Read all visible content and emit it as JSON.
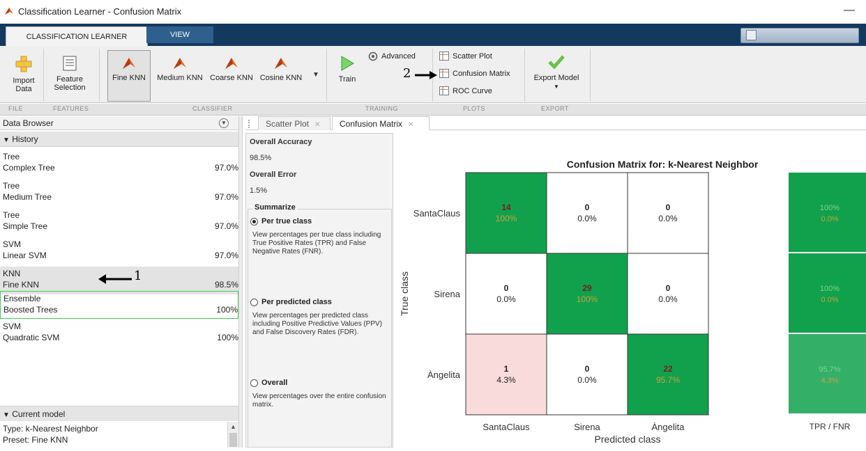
{
  "window": {
    "title": "Classification Learner - Confusion Matrix",
    "minimize": "—"
  },
  "tabs": {
    "app": "CLASSIFICATION LEARNER",
    "view": "VIEW"
  },
  "ribbon": {
    "import": [
      "Import",
      "Data"
    ],
    "feature": [
      "Feature",
      "Selection"
    ],
    "classifiers": [
      "Fine KNN",
      "Medium KNN",
      "Coarse KNN",
      "Cosine KNN"
    ],
    "advanced": "Advanced",
    "train": "Train",
    "plots": [
      "Scatter Plot",
      "Confusion Matrix",
      "ROC Curve"
    ],
    "export": "Export Model",
    "groups": [
      "FILE",
      "FEATURES",
      "CLASSIFIER",
      "TRAINING",
      "PLOTS",
      "EXPORT"
    ],
    "annotation": "2"
  },
  "data_browser": {
    "title": "Data Browser",
    "history_label": "History",
    "items": [
      {
        "type": "Tree",
        "name": "Complex Tree",
        "acc": "97.0%"
      },
      {
        "type": "Tree",
        "name": "Medium Tree",
        "acc": "97.0%"
      },
      {
        "type": "Tree",
        "name": "Simple Tree",
        "acc": "97.0%"
      },
      {
        "type": "SVM",
        "name": "Linear SVM",
        "acc": "97.0%"
      },
      {
        "type": "KNN",
        "name": "Fine KNN",
        "acc": "98.5%"
      },
      {
        "type": "Ensemble",
        "name": "Boosted Trees",
        "acc": "100%"
      },
      {
        "type": "SVM",
        "name": "Quadratic SVM",
        "acc": "100%"
      }
    ],
    "annotation": "1",
    "current_model_label": "Current model",
    "current_model": [
      "Type: k-Nearest Neighbor",
      "Preset: Fine KNN"
    ]
  },
  "doc_tabs": [
    "Scatter Plot",
    "Confusion Matrix"
  ],
  "summary": {
    "overall_accuracy_label": "Overall Accuracy",
    "overall_accuracy": "98.5%",
    "overall_error_label": "Overall Error",
    "overall_error": "1.5%",
    "summarize_label": "Summarize",
    "options": [
      {
        "label": "Per true class",
        "desc": "View percentages per true class including True Positive Rates (TPR) and False Negative Rates (FNR)."
      },
      {
        "label": "Per predicted class",
        "desc": "View percentages per predicted class including Positive Predictive Values (PPV) and False Discovery Rates (FDR)."
      },
      {
        "label": "Overall",
        "desc": "View percentages over the entire confusion matrix."
      }
    ]
  },
  "colors": {
    "good": "#11a14d",
    "bad": "#fadbdb",
    "ribbon_dark": "#14395f"
  },
  "chart_data": {
    "type": "heatmap",
    "title": "Confusion Matrix for: k-Nearest Neighbor",
    "xlabel": "Predicted class",
    "ylabel": "True class",
    "rows": [
      "SantaClaus",
      "Sirena",
      "Àngelita"
    ],
    "cols": [
      "SantaClaus",
      "Sirena",
      "Àngelita"
    ],
    "counts": [
      [
        14,
        0,
        0
      ],
      [
        0,
        29,
        0
      ],
      [
        1,
        0,
        22
      ]
    ],
    "percent": [
      [
        "100%",
        "0.0%",
        "0.0%"
      ],
      [
        "0.0%",
        "100%",
        "0.0%"
      ],
      [
        "4.3%",
        "0.0%",
        "95.7%"
      ]
    ],
    "side_label": "TPR / FNR",
    "side_values": [
      [
        "100%",
        "0.0%"
      ],
      [
        "100%",
        "0.0%"
      ],
      [
        "95.7%",
        "4.3%"
      ]
    ]
  }
}
